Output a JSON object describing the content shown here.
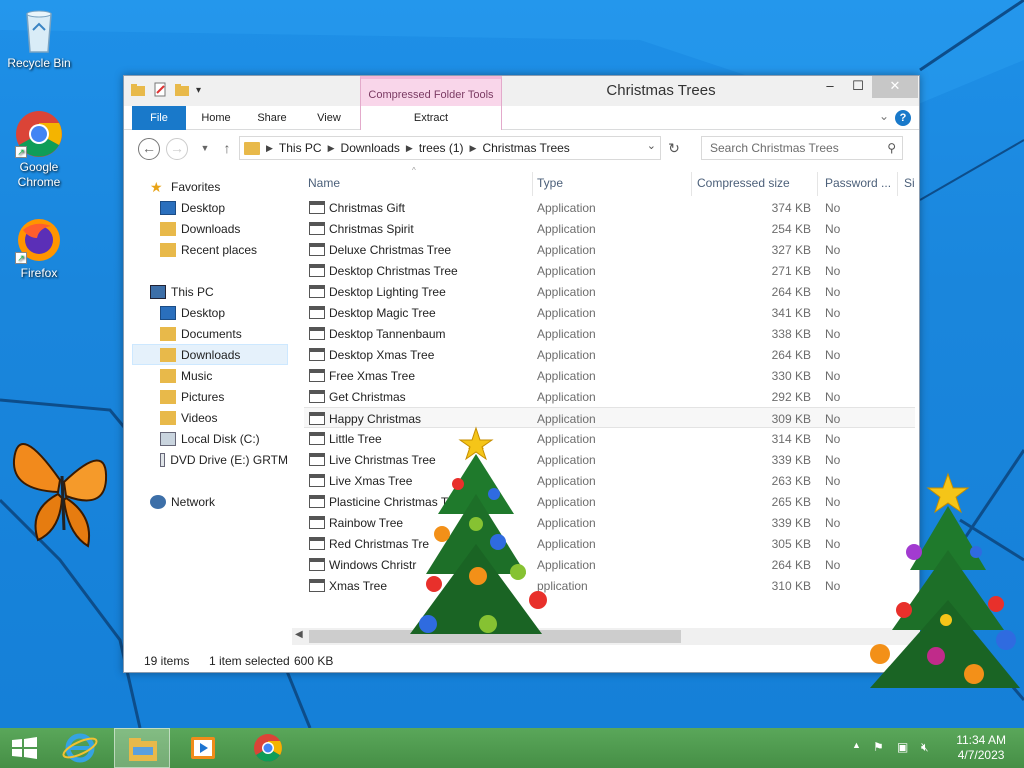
{
  "desktop": {
    "icons": [
      {
        "label": "Recycle Bin",
        "icon": "recycle-bin-icon"
      },
      {
        "label": "Google Chrome",
        "icon": "chrome-icon"
      },
      {
        "label": "Firefox",
        "icon": "firefox-icon"
      }
    ]
  },
  "window": {
    "title": "Christmas Trees",
    "context_tab": "Compressed Folder Tools",
    "tabs": {
      "file": "File",
      "home": "Home",
      "share": "Share",
      "view": "View",
      "extract": "Extract"
    },
    "breadcrumb": [
      "This PC",
      "Downloads",
      "trees (1)",
      "Christmas Trees"
    ],
    "search_placeholder": "Search Christmas Trees",
    "nav": {
      "favorites": "Favorites",
      "fav_items": [
        "Desktop",
        "Downloads",
        "Recent places"
      ],
      "this_pc": "This PC",
      "pc_items": [
        "Desktop",
        "Documents",
        "Downloads",
        "Music",
        "Pictures",
        "Videos",
        "Local Disk (C:)",
        "DVD Drive (E:) GRTM"
      ],
      "network": "Network"
    },
    "columns": {
      "name": "Name",
      "type": "Type",
      "size": "Compressed size",
      "password": "Password ...",
      "extra": "Si"
    },
    "files": [
      {
        "name": "Christmas Gift",
        "type": "Application",
        "size": "374 KB",
        "password": "No"
      },
      {
        "name": "Christmas Spirit",
        "type": "Application",
        "size": "254 KB",
        "password": "No"
      },
      {
        "name": "Deluxe Christmas Tree",
        "type": "Application",
        "size": "327 KB",
        "password": "No"
      },
      {
        "name": "Desktop Christmas Tree",
        "type": "Application",
        "size": "271 KB",
        "password": "No"
      },
      {
        "name": "Desktop Lighting Tree",
        "type": "Application",
        "size": "264 KB",
        "password": "No"
      },
      {
        "name": "Desktop Magic Tree",
        "type": "Application",
        "size": "341 KB",
        "password": "No"
      },
      {
        "name": "Desktop Tannenbaum",
        "type": "Application",
        "size": "338 KB",
        "password": "No"
      },
      {
        "name": "Desktop Xmas Tree",
        "type": "Application",
        "size": "264 KB",
        "password": "No"
      },
      {
        "name": "Free Xmas Tree",
        "type": "Application",
        "size": "330 KB",
        "password": "No"
      },
      {
        "name": "Get Christmas",
        "type": "Application",
        "size": "292 KB",
        "password": "No"
      },
      {
        "name": "Happy Christmas",
        "type": "Application",
        "size": "309 KB",
        "password": "No"
      },
      {
        "name": "Little Tree",
        "type": "Application",
        "size": "314 KB",
        "password": "No"
      },
      {
        "name": "Live Christmas Tree",
        "type": "Application",
        "size": "339 KB",
        "password": "No"
      },
      {
        "name": "Live Xmas Tree",
        "type": "Application",
        "size": "263 KB",
        "password": "No"
      },
      {
        "name": "Plasticine Christmas T",
        "type": "Application",
        "size": "265 KB",
        "password": "No"
      },
      {
        "name": "Rainbow Tree",
        "type": "Application",
        "size": "339 KB",
        "password": "No"
      },
      {
        "name": "Red Christmas Tre",
        "type": "Application",
        "size": "305 KB",
        "password": "No"
      },
      {
        "name": "Windows Christr",
        "type": "Application",
        "size": "264 KB",
        "password": "No"
      },
      {
        "name": "Xmas Tree",
        "type": "pplication",
        "size": "310 KB",
        "password": "No"
      }
    ],
    "status": {
      "count": "19 items",
      "selected": "1 item selected",
      "size": "600 KB"
    }
  },
  "taskbar": {
    "time": "11:34 AM",
    "date": "4/7/2023"
  }
}
